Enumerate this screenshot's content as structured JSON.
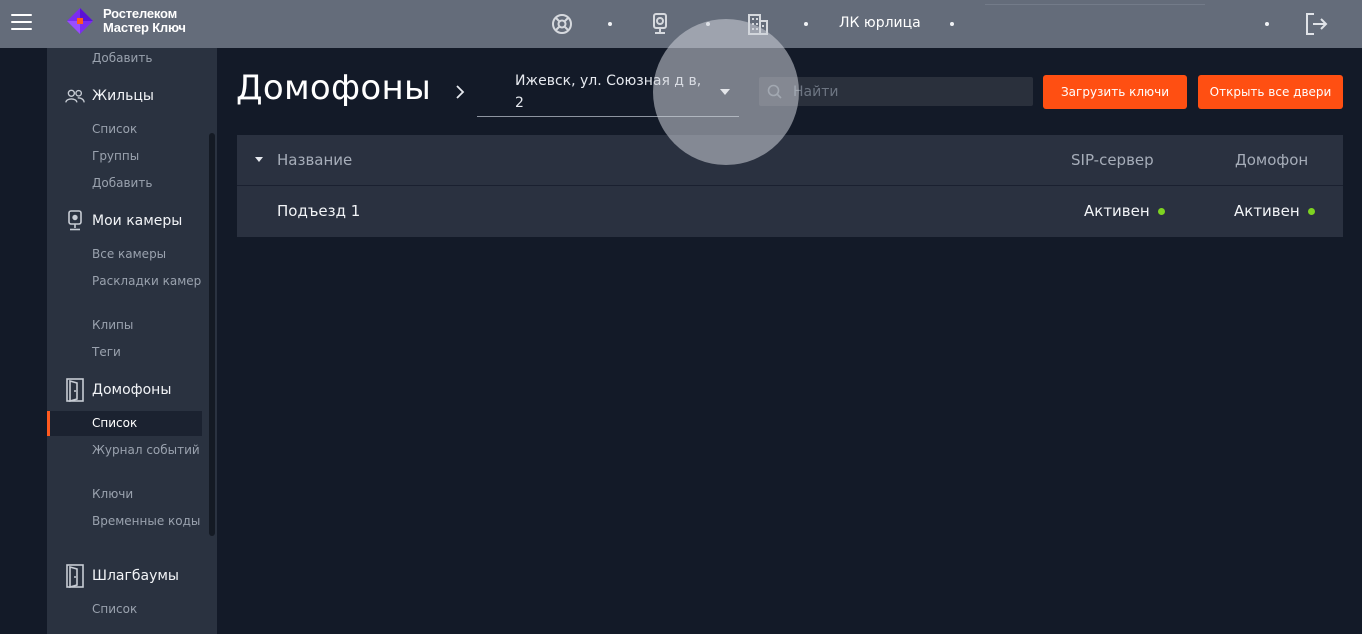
{
  "header": {
    "brand_line1": "Ростелеком",
    "brand_line2": "Мастер Ключ",
    "account_label": "ЛК юрлица",
    "icons": [
      "menu-icon",
      "support-icon",
      "camera-icon",
      "building-icon",
      "logout-icon"
    ]
  },
  "sidebar": {
    "top_sub": "Добавить",
    "residents": {
      "label": "Жильцы",
      "items": [
        "Список",
        "Группы",
        "Добавить"
      ]
    },
    "cameras": {
      "label": "Мои камеры",
      "items": [
        "Все камеры",
        "Раскладки камер",
        "Клипы",
        "Теги"
      ]
    },
    "intercoms": {
      "label": "Домофоны",
      "items": [
        "Список",
        "Журнал событий",
        "Ключи",
        "Временные коды"
      ],
      "active_item": "Список"
    },
    "barriers": {
      "label": "Шлагбаумы",
      "items": [
        "Список"
      ]
    }
  },
  "main": {
    "title": "Домофоны",
    "address": "Ижевск, ул. Союзная д в, 2",
    "search_placeholder": "Найти",
    "upload_keys_label": "Загрузить ключи",
    "open_all_label": "Открыть все двери"
  },
  "table": {
    "columns": [
      "Название",
      "SIP-сервер",
      "Домофон"
    ],
    "rows": [
      {
        "name": "Подъезд 1",
        "sip": "Активен",
        "intercom": "Активен"
      }
    ]
  },
  "colors": {
    "accent": "#ff4f12",
    "status_active": "#7ed321",
    "topbar": "#646c7a",
    "sidebar": "#2a3240",
    "background": "#131a28"
  }
}
